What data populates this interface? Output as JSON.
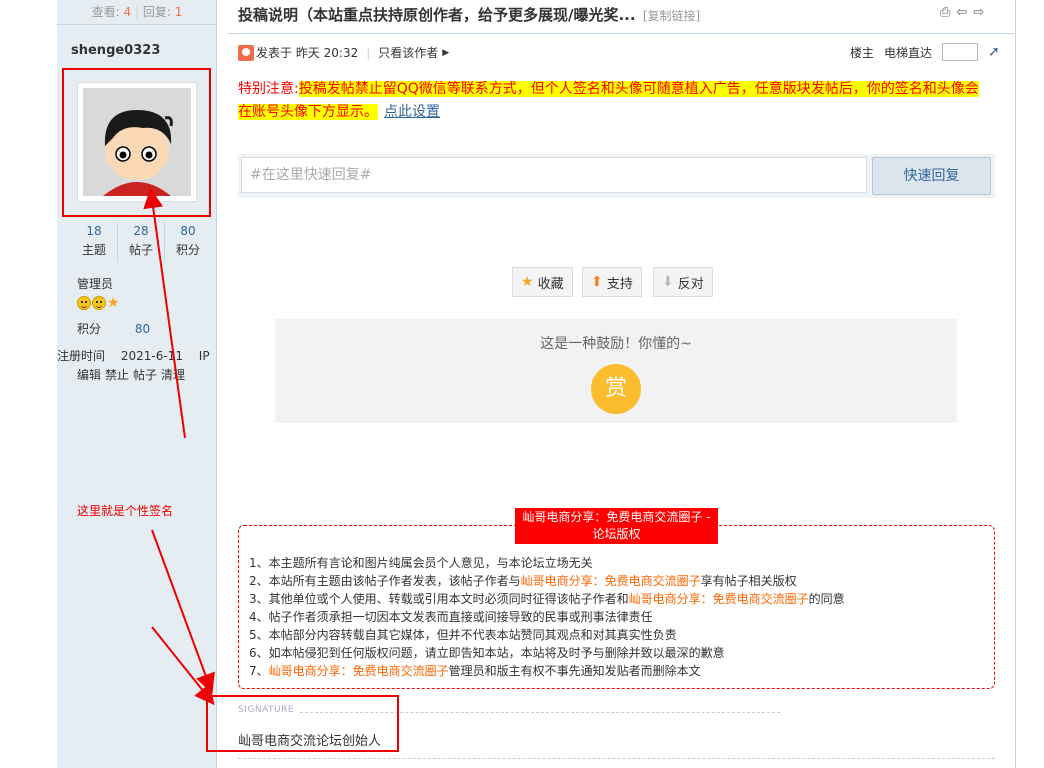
{
  "stats_bar": {
    "views_label": "查看:",
    "views": "4",
    "replies_label": "回复:",
    "replies": "1"
  },
  "thread": {
    "title": "投稿说明（本站重点扶持原创作者，给予更多展现/曝光奖...",
    "copy_link": "[复制链接]"
  },
  "user": {
    "name": "shenge0323",
    "stats": [
      {
        "value": "18",
        "label": "主题"
      },
      {
        "value": "28",
        "label": "帖子"
      },
      {
        "value": "80",
        "label": "积分"
      }
    ],
    "group": "管理员",
    "credits_label": "积分",
    "credits_value": "80",
    "reg_label": "注册时间",
    "reg_date": "2021-6-11",
    "ip_label": "IP",
    "admin_links": [
      "编辑",
      "禁止",
      "帖子",
      "清理"
    ]
  },
  "post_meta": {
    "posted_label": "发表于 昨天 20:32",
    "only_author": "只看该作者",
    "floor_label": "楼主",
    "jump_label": "电梯直达"
  },
  "notice": {
    "lead": "特别注意:",
    "highlight": "投稿发帖禁止留QQ微信等联系方式，但个人签名和头像可随意植入广告，任意版块发帖后，你的签名和头像会在账号头像下方显示。",
    "link": "点此设置"
  },
  "quick_reply": {
    "placeholder": "#在这里快速回复#",
    "button": "快速回复"
  },
  "votes": {
    "favorite": "收藏",
    "support": "支持",
    "oppose": "反对"
  },
  "reward": {
    "text": "这是一种鼓励！你懂的~",
    "coin": "赏"
  },
  "copyright": {
    "title": "屾哥电商分享：免费电商交流圈子 - 论坛版权",
    "lines": [
      {
        "pre": "1、本主题所有言论和图片纯属会员个人意见，与本论坛立场无关",
        "org": "",
        "post": ""
      },
      {
        "pre": "2、本站所有主题由该帖子作者发表，该帖子作者与",
        "org": "屾哥电商分享：免费电商交流圈子",
        "post": "享有帖子相关版权"
      },
      {
        "pre": "3、其他单位或个人使用、转载或引用本文时必须同时征得该帖子作者和",
        "org": "屾哥电商分享：免费电商交流圈子",
        "post": "的同意"
      },
      {
        "pre": "4、帖子作者须承担一切因本文发表而直接或间接导致的民事或刑事法律责任",
        "org": "",
        "post": ""
      },
      {
        "pre": "5、本帖部分内容转载自其它媒体，但并不代表本站赞同其观点和对其真实性负责",
        "org": "",
        "post": ""
      },
      {
        "pre": "6、如本帖侵犯到任何版权问题，请立即告知本站，本站将及时予与删除并致以最深的歉意",
        "org": "",
        "post": ""
      },
      {
        "pre": "7、",
        "org": "屾哥电商分享：免费电商交流圈子",
        "post": "管理员和版主有权不事先通知发贴者而删除本文"
      }
    ]
  },
  "signature": {
    "label": "SIGNATURE",
    "text": "屾哥电商交流论坛创始人"
  },
  "annotation": {
    "text": "这里就是个性签名",
    "color": "#ee0000"
  }
}
